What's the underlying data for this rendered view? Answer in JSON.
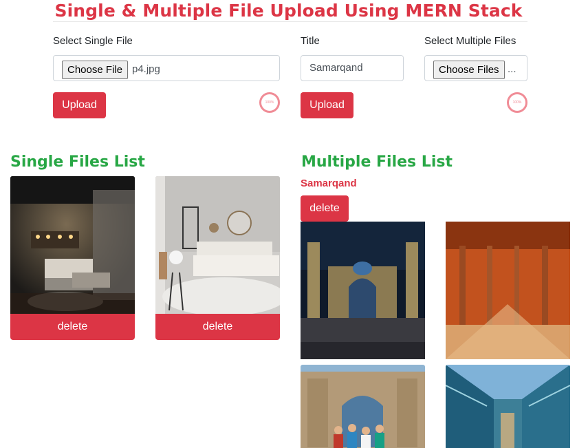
{
  "header": {
    "title": "Single & Multiple File Upload Using MERN Stack"
  },
  "single_upload": {
    "label": "Select Single File",
    "choose_button": "Choose File",
    "selected_file": "p4.jpg",
    "upload_button": "Upload",
    "progress_text": "100%",
    "progress": 1.0
  },
  "multiple_upload": {
    "title_label": "Title",
    "title_value": "Samarqand",
    "files_label": "Select Multiple Files",
    "choose_button": "Choose Files",
    "selected_summary": "...",
    "upload_button": "Upload",
    "progress_text": "100%",
    "progress": 1.0
  },
  "single_list": {
    "heading": "Single Files List",
    "items": [
      {
        "delete_label": "delete",
        "image": "bedroom-dark-photo"
      },
      {
        "delete_label": "delete",
        "image": "bedroom-light-photo"
      }
    ]
  },
  "multiple_list": {
    "heading": "Multiple Files List",
    "albums": [
      {
        "title": "Samarqand",
        "delete_label": "delete",
        "images": [
          "registan-night-photo",
          "colonnade-photo",
          "madrasa-tourists-photo",
          "blue-tile-street-photo"
        ]
      }
    ]
  },
  "colors": {
    "danger": "#dc3545",
    "success": "#28a745",
    "progress": "#f08c96"
  }
}
